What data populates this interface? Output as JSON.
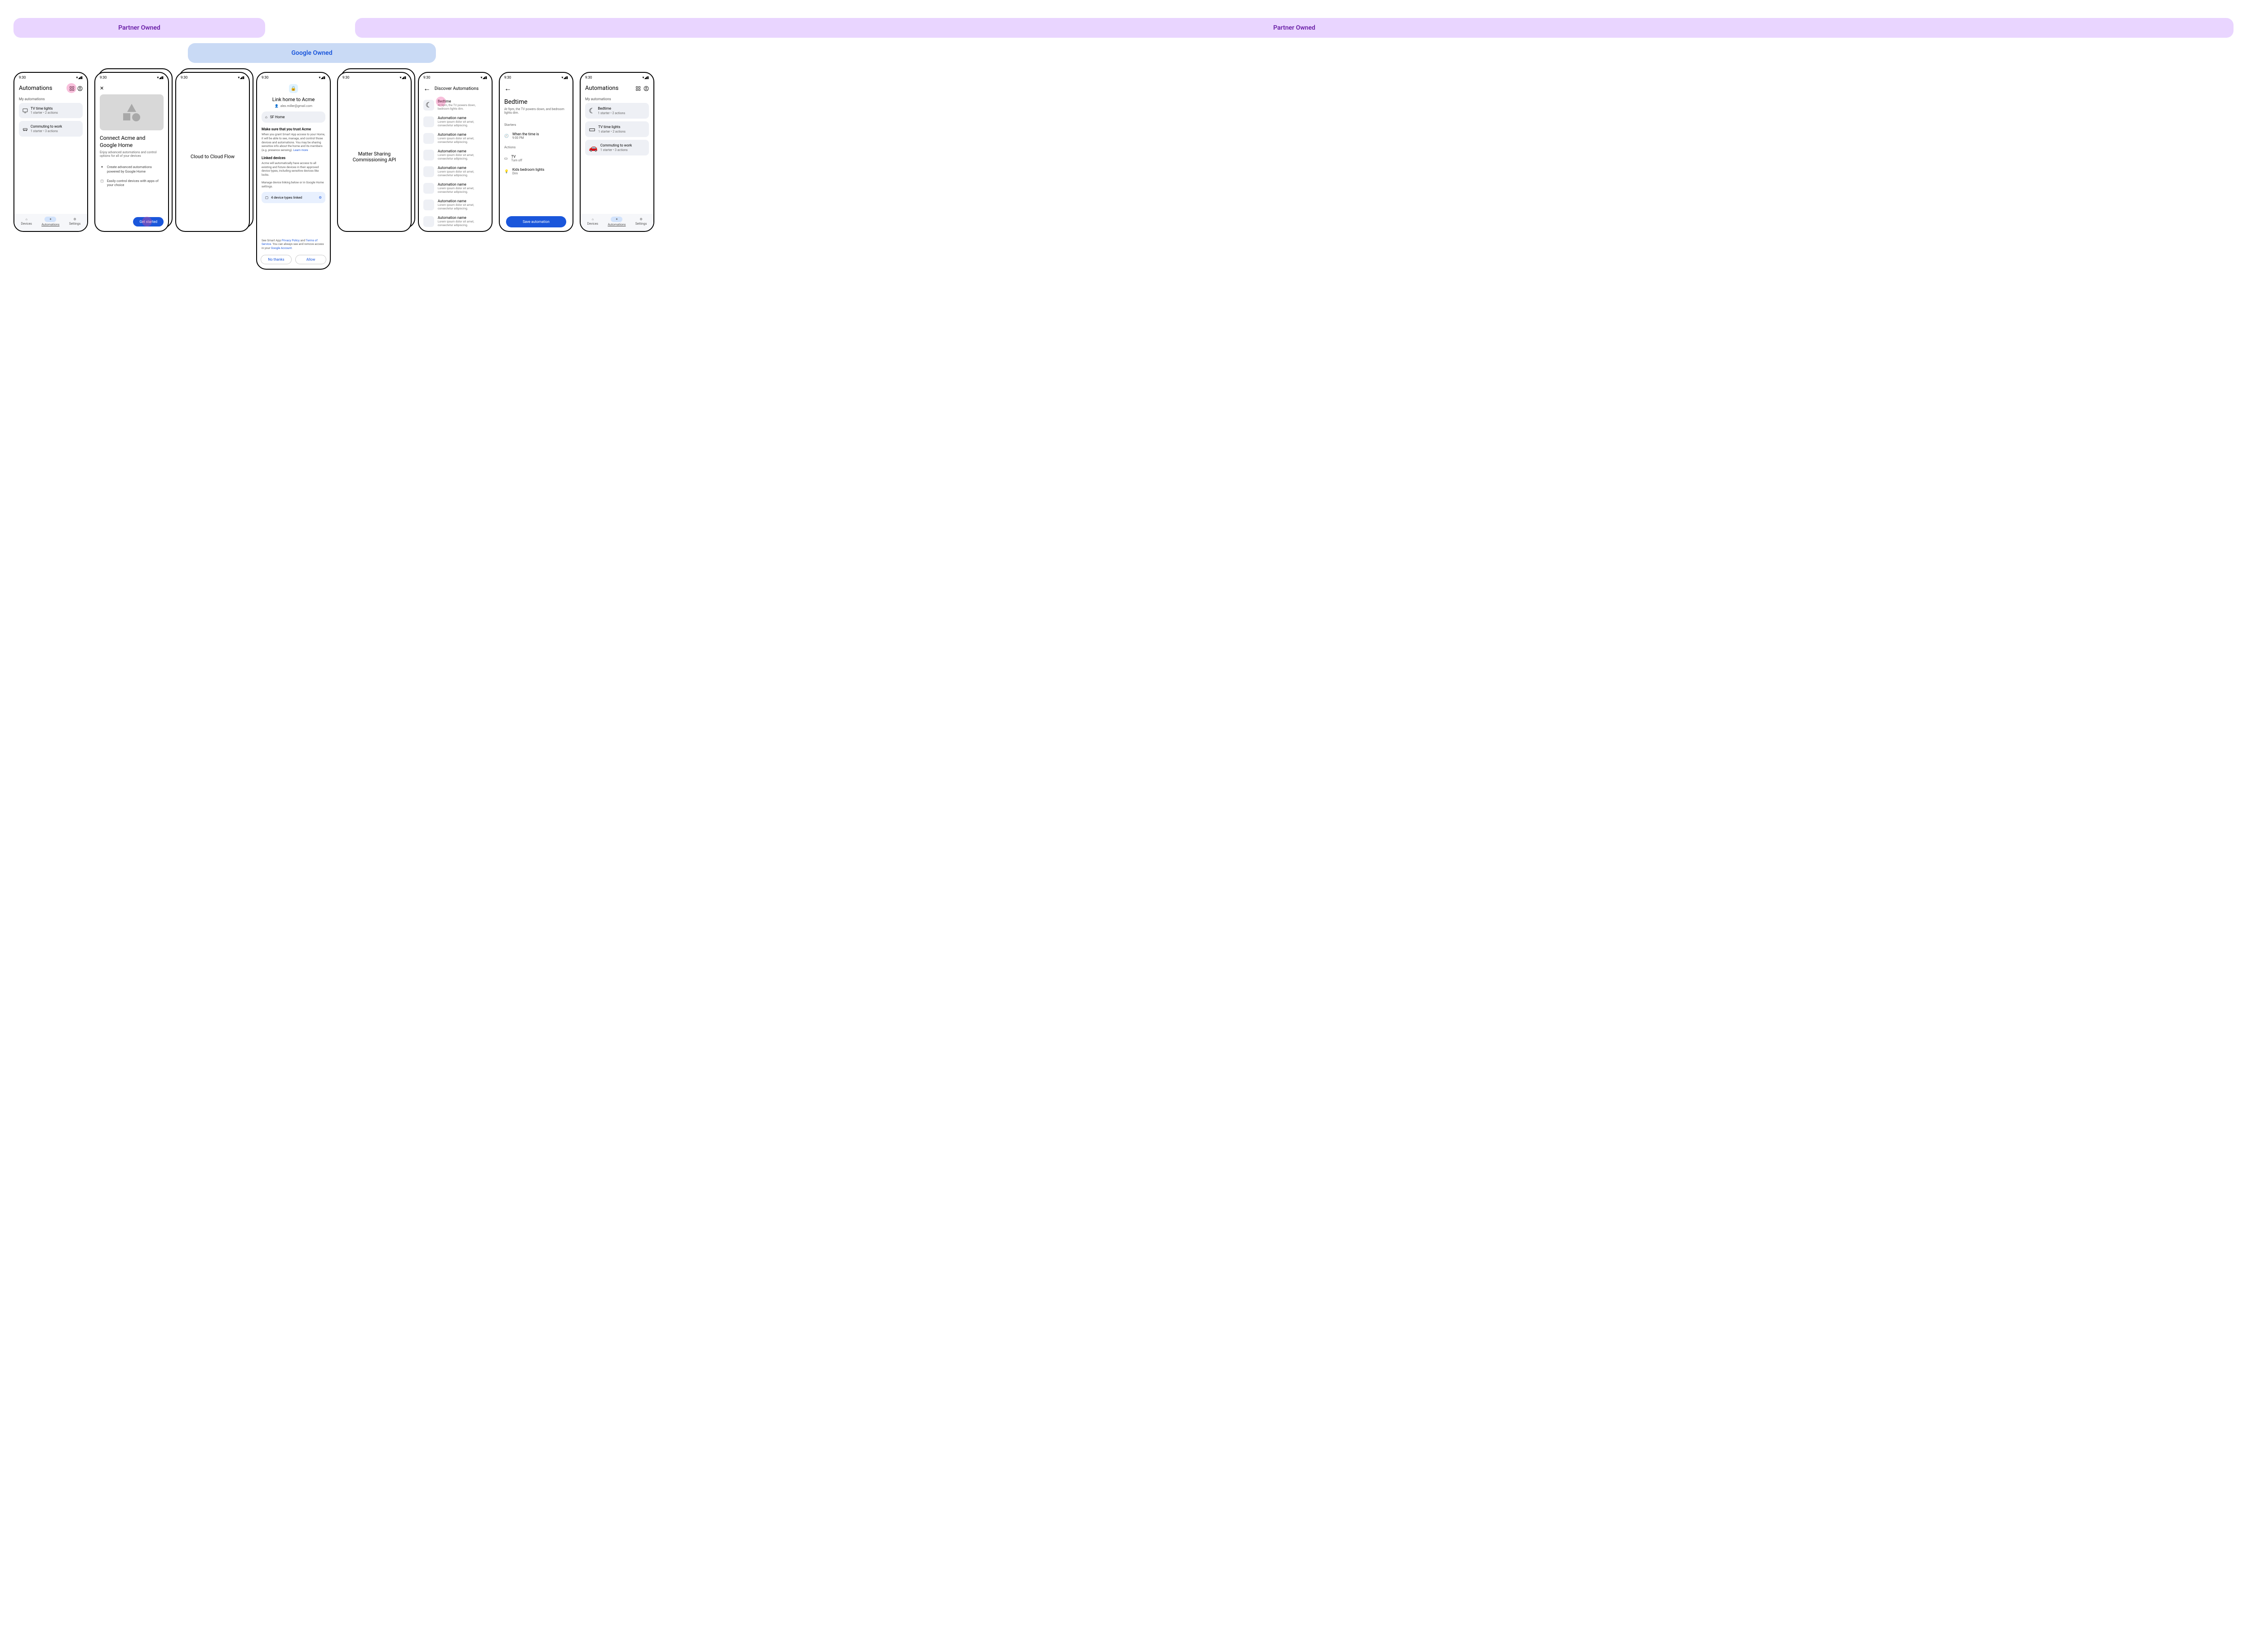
{
  "tags": {
    "partner_a": "Partner Owned",
    "google": "Google Owned",
    "partner_b": "Partner Owned"
  },
  "status_time": "9:30",
  "s1": {
    "title": "Automations",
    "section": "My automations",
    "auto1_title": "TV time lights",
    "auto1_sub": "1 starter • 2 actions",
    "auto2_title": "Commuting to work",
    "auto2_sub": "1 starter • 3 actions",
    "nav_devices": "Devices",
    "nav_auto": "Automations",
    "nav_settings": "Settings"
  },
  "s2": {
    "title": "Connect Acme and Google Home",
    "sub": "Enjoy advanced automations and control options for all of your devices",
    "b1": "Create advanced automations powered by Google Home",
    "b2": "Easily control devices with apps of your choice",
    "btn": "Get started"
  },
  "s3": {
    "text": "Cloud to Cloud Flow"
  },
  "s4": {
    "title": "Link home to Acme",
    "email": "alex.miller@gmail.com",
    "home": "SF Home",
    "h1": "Make sure that you trust Acme",
    "p1a": "When you grant Smart App access to your Home, it will be able to  see, manage, and control those devices and automations. You may be sharing sensitive info about the home and its members (e.g. presence sensing). ",
    "p1link": "Learn more",
    "h2": "Linked devices",
    "p2": "Acme will automatically have access to all existing and future devices in their approved device types, including sensitive devices like locks.",
    "p3": "Manage device linking below or in Google Home settings.",
    "count": "4 device types linked",
    "legal_a": "See Smart App ",
    "legal_pp": "Privacy Policy",
    "legal_b": " and ",
    "legal_tos": "Terms of Service",
    "legal_c": ". You can always see and remove access in your ",
    "legal_ga": "Google Account",
    "legal_d": ".",
    "no": "No thanks",
    "allow": "Allow"
  },
  "s5": {
    "text": "Matter Sharing Commissioning API"
  },
  "s6": {
    "title": "Discover Automations",
    "item_title": "Bedtime",
    "item_sub": "At 9pm, the TV powers down, bedroom lights dim.",
    "gen_title": "Automation name",
    "gen_sub": "Lorem ipsum dolor sit amet, consectetur adipiscing."
  },
  "s7": {
    "title": "Bedtime",
    "desc": "At 9pm, the TV powers down, and bedroom lights dim.",
    "starters": "Starters",
    "start1": "When the time is",
    "start1_sub": "9:00 PM",
    "actions": "Actions",
    "act1": "TV",
    "act1_sub": "Turn off",
    "act2": "Kids bedroom lights",
    "act2_sub": "Dim",
    "save": "Save automation"
  },
  "s8": {
    "title": "Automations",
    "section": "My automations",
    "a1_title": "Bedtime",
    "a1_sub": "1 starter • 2 actions",
    "a2_title": "TV time lights",
    "a2_sub": "1 starter • 2 actions",
    "a3_title": "Commuting to work",
    "a3_sub": "1 starter • 3 actions",
    "nav_devices": "Devices",
    "nav_auto": "Automations",
    "nav_settings": "Settings"
  }
}
